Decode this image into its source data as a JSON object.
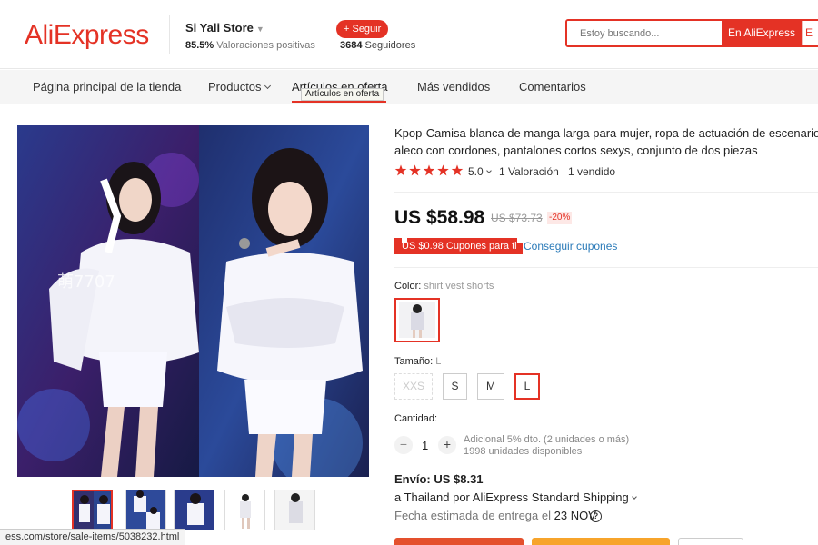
{
  "header": {
    "logo": "AliExpress",
    "store_name": "Si Yali Store",
    "store_rating_value": "85.5%",
    "store_rating_label": "Valoraciones positivas",
    "follow_label": "+ Seguir",
    "followers_count": "3684",
    "followers_label": "Seguidores",
    "search_placeholder": "Estoy buscando...",
    "search_button": "En AliExpress",
    "search_button2": "E"
  },
  "nav": {
    "items": [
      "Página principal de la tienda",
      "Productos",
      "Artículos en oferta",
      "Más vendidos",
      "Comentarios"
    ],
    "tooltip": "Artículos en oferta"
  },
  "product": {
    "title_line1": "Kpop-Camisa blanca de manga larga para mujer, ropa de actuación de escenario, ch",
    "title_line2": "aleco con cordones, pantalones cortos sexys, conjunto de dos piezas",
    "rating": "5.0",
    "rating_stars": 5,
    "reviews": "1 Valoración",
    "sold": "1 vendido",
    "price": "US $58.98",
    "old_price": "US $73.73",
    "discount": "-20%",
    "coupon": "US $0.98 Cupones para ti",
    "get_coupon": "Conseguir cupones",
    "color_label": "Color:",
    "color_value": "shirt vest shorts",
    "size_label": "Tamaño:",
    "size_value": "L",
    "sizes": [
      "XXS",
      "S",
      "M",
      "L"
    ],
    "quantity_label": "Cantidad:",
    "quantity": "1",
    "qty_minus": "−",
    "qty_plus": "+",
    "qty_note1": "Adicional 5% dto. (2 unidades o más)",
    "qty_note2": "1998 unidades disponibles",
    "shipping_title": "Envío: US $8.31",
    "shipping_line": "a Thailand por AliExpress Standard Shipping",
    "delivery_label": "Fecha estimada de entrega el",
    "delivery_date": "23 NOV",
    "help": "?",
    "image_watermark": "萌7707"
  },
  "status_bar": "ess.com/store/sale-items/5038232.html",
  "colors": {
    "brand": "#e43225",
    "link": "#2a7ab8"
  }
}
